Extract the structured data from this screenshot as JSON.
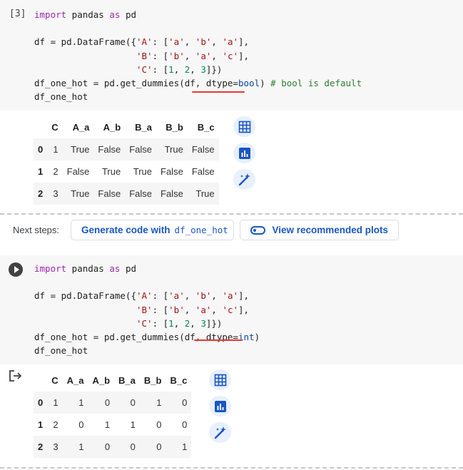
{
  "cell1": {
    "exec_count": "[3]",
    "lines": [
      [
        {
          "t": "import",
          "c": "kw"
        },
        {
          "t": " pandas ",
          "c": ""
        },
        {
          "t": "as",
          "c": "kw"
        },
        {
          "t": " pd",
          "c": ""
        }
      ],
      [],
      [
        {
          "t": "df = pd.DataFrame({",
          "c": ""
        },
        {
          "t": "'A'",
          "c": "str"
        },
        {
          "t": ": [",
          "c": ""
        },
        {
          "t": "'a'",
          "c": "str"
        },
        {
          "t": ", ",
          "c": ""
        },
        {
          "t": "'b'",
          "c": "str"
        },
        {
          "t": ", ",
          "c": ""
        },
        {
          "t": "'a'",
          "c": "str"
        },
        {
          "t": "],",
          "c": ""
        }
      ],
      [
        {
          "t": "                   ",
          "c": ""
        },
        {
          "t": "'B'",
          "c": "str"
        },
        {
          "t": ": [",
          "c": ""
        },
        {
          "t": "'b'",
          "c": "str"
        },
        {
          "t": ", ",
          "c": ""
        },
        {
          "t": "'a'",
          "c": "str"
        },
        {
          "t": ", ",
          "c": ""
        },
        {
          "t": "'c'",
          "c": "str"
        },
        {
          "t": "],",
          "c": ""
        }
      ],
      [
        {
          "t": "                   ",
          "c": ""
        },
        {
          "t": "'C'",
          "c": "str"
        },
        {
          "t": ": [",
          "c": ""
        },
        {
          "t": "1",
          "c": "num"
        },
        {
          "t": ", ",
          "c": ""
        },
        {
          "t": "2",
          "c": "num"
        },
        {
          "t": ", ",
          "c": ""
        },
        {
          "t": "3",
          "c": "num"
        },
        {
          "t": "]})",
          "c": ""
        }
      ],
      [
        {
          "t": "df_one_hot = pd.get_dummies(df, ",
          "c": ""
        },
        {
          "t": "dtype",
          "c": "param"
        },
        {
          "t": "=",
          "c": ""
        },
        {
          "t": "bool",
          "c": "val"
        },
        {
          "t": ") ",
          "c": ""
        },
        {
          "t": "# bool is default",
          "c": "cm"
        }
      ],
      [
        {
          "t": "df_one_hot",
          "c": ""
        }
      ]
    ]
  },
  "output1": {
    "columns": [
      "C",
      "A_a",
      "A_b",
      "B_a",
      "B_b",
      "B_c"
    ],
    "rows": [
      {
        "index": "0",
        "cells": [
          "1",
          "True",
          "False",
          "False",
          "True",
          "False"
        ]
      },
      {
        "index": "1",
        "cells": [
          "2",
          "False",
          "True",
          "True",
          "False",
          "False"
        ]
      },
      {
        "index": "2",
        "cells": [
          "3",
          "True",
          "False",
          "False",
          "False",
          "True"
        ]
      }
    ]
  },
  "next_steps": {
    "label": "Next steps:",
    "generate_label": "Generate code with",
    "generate_var": "df_one_hot",
    "plots_label": "View recommended plots"
  },
  "cell2": {
    "lines": [
      [
        {
          "t": "import",
          "c": "kw"
        },
        {
          "t": " pandas ",
          "c": ""
        },
        {
          "t": "as",
          "c": "kw"
        },
        {
          "t": " pd",
          "c": ""
        }
      ],
      [],
      [
        {
          "t": "df = pd.DataFrame({",
          "c": ""
        },
        {
          "t": "'A'",
          "c": "str"
        },
        {
          "t": ": [",
          "c": ""
        },
        {
          "t": "'a'",
          "c": "str"
        },
        {
          "t": ", ",
          "c": ""
        },
        {
          "t": "'b'",
          "c": "str"
        },
        {
          "t": ", ",
          "c": ""
        },
        {
          "t": "'a'",
          "c": "str"
        },
        {
          "t": "],",
          "c": ""
        }
      ],
      [
        {
          "t": "                   ",
          "c": ""
        },
        {
          "t": "'B'",
          "c": "str"
        },
        {
          "t": ": [",
          "c": ""
        },
        {
          "t": "'b'",
          "c": "str"
        },
        {
          "t": ", ",
          "c": ""
        },
        {
          "t": "'a'",
          "c": "str"
        },
        {
          "t": ", ",
          "c": ""
        },
        {
          "t": "'c'",
          "c": "str"
        },
        {
          "t": "],",
          "c": ""
        }
      ],
      [
        {
          "t": "                   ",
          "c": ""
        },
        {
          "t": "'C'",
          "c": "str"
        },
        {
          "t": ": [",
          "c": ""
        },
        {
          "t": "1",
          "c": "num"
        },
        {
          "t": ", ",
          "c": ""
        },
        {
          "t": "2",
          "c": "num"
        },
        {
          "t": ", ",
          "c": ""
        },
        {
          "t": "3",
          "c": "num"
        },
        {
          "t": "]})",
          "c": ""
        }
      ],
      [
        {
          "t": "df_one_hot = pd.get_dummies(df, ",
          "c": ""
        },
        {
          "t": "dtype",
          "c": "param"
        },
        {
          "t": "=",
          "c": ""
        },
        {
          "t": "int",
          "c": "val"
        },
        {
          "t": ")",
          "c": ""
        }
      ],
      [
        {
          "t": "df_one_hot",
          "c": ""
        }
      ]
    ]
  },
  "output2": {
    "columns": [
      "C",
      "A_a",
      "A_b",
      "B_a",
      "B_b",
      "B_c"
    ],
    "rows": [
      {
        "index": "0",
        "cells": [
          "1",
          "1",
          "0",
          "0",
          "1",
          "0"
        ]
      },
      {
        "index": "1",
        "cells": [
          "2",
          "0",
          "1",
          "1",
          "0",
          "0"
        ]
      },
      {
        "index": "2",
        "cells": [
          "3",
          "1",
          "0",
          "0",
          "0",
          "1"
        ]
      }
    ]
  },
  "icons": {
    "run": "play-circle-icon",
    "output": "output-redirect-icon",
    "table": "table-icon",
    "chart": "bar-chart-icon",
    "magic": "magic-wand-icon",
    "toggle": "toggle-icon"
  },
  "colors": {
    "accent": "#1a56c4",
    "annotation": "#e53935",
    "keyword": "#9c27b0",
    "string": "#a31515",
    "comment": "#2e7d32"
  }
}
